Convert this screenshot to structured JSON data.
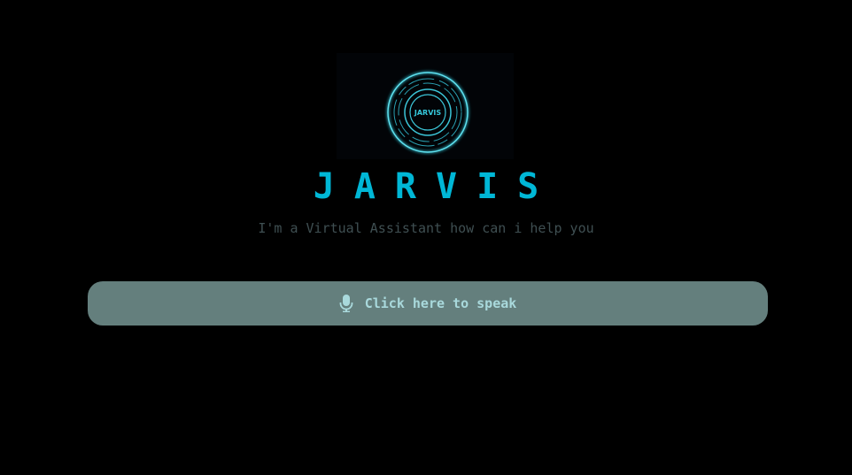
{
  "logo": {
    "text": "JARVIS",
    "color": "#35c9dc"
  },
  "header": {
    "title": "JARVIS",
    "subtitle": "I'm a Virtual Assistant how can i help you"
  },
  "speak_button": {
    "label": "Click here to speak",
    "icon": "microphone-icon"
  },
  "colors": {
    "accent": "#00b7d6",
    "button_bg": "#647f7d",
    "button_text": "#a9d9dc"
  }
}
